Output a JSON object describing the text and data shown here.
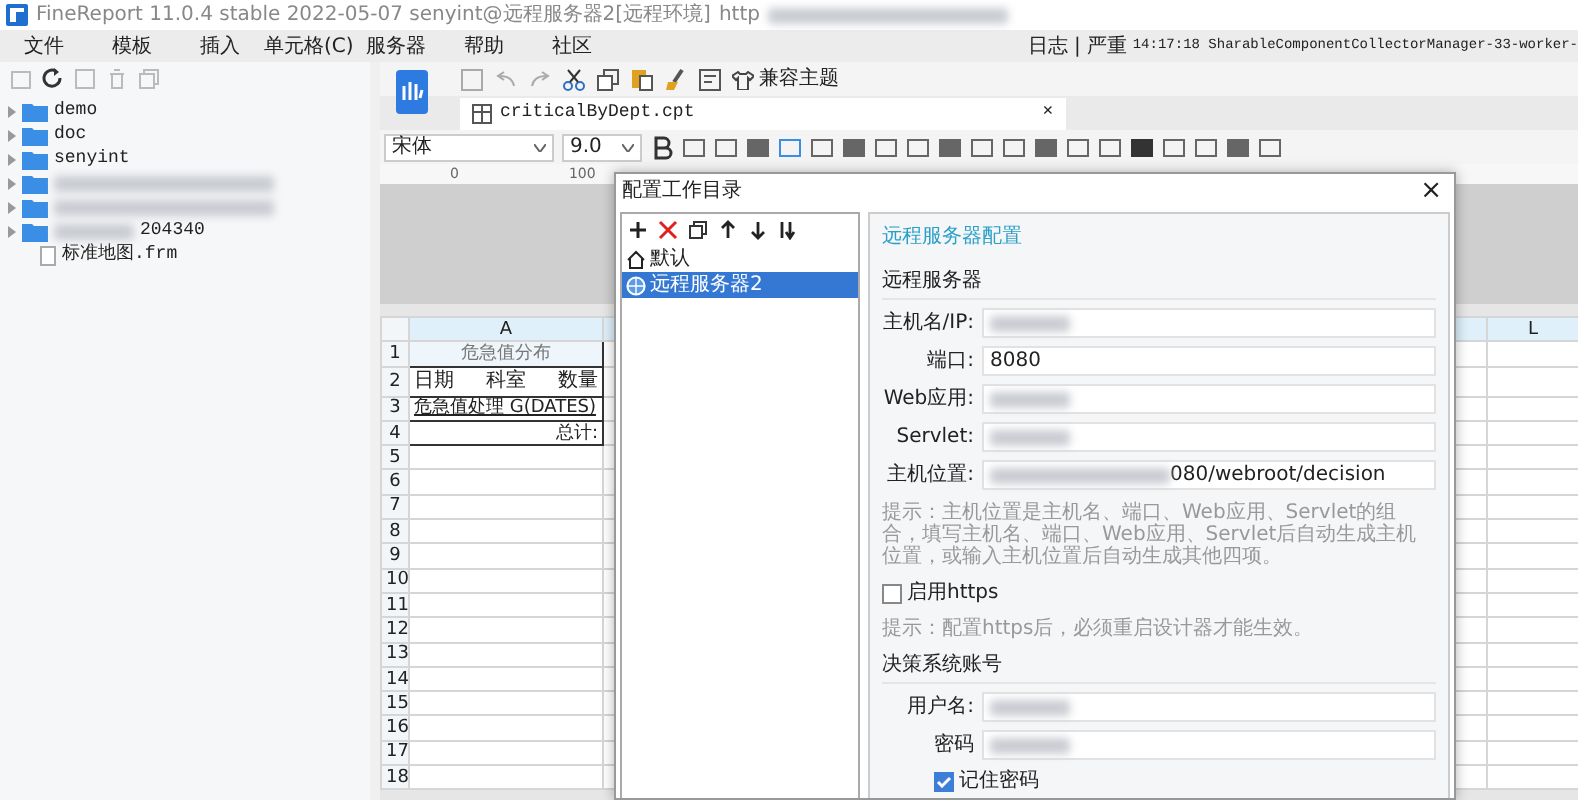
{
  "window": {
    "title": "FineReport 11.0.4 stable 2022-05-07 senyint@远程服务器2[远程环境]",
    "url_fragment": "http"
  },
  "menu": [
    "文件",
    "模板",
    "插入",
    "单元格(C)",
    "服务器",
    "帮助",
    "社区"
  ],
  "log_bar": {
    "label": "日志",
    "separator": "|",
    "level": "严重",
    "message": "14:17:18 SharableComponentCollectorManager-33-worker-"
  },
  "file_tree": [
    {
      "kind": "folder",
      "label": "demo"
    },
    {
      "kind": "folder",
      "label": "doc"
    },
    {
      "kind": "folder",
      "label": "senyint"
    },
    {
      "kind": "folder",
      "redacted": true
    },
    {
      "kind": "folder",
      "redacted": true
    },
    {
      "kind": "folder",
      "label": "204340",
      "redacted": true
    },
    {
      "kind": "file",
      "label": "标准地图.frm"
    }
  ],
  "toolbar": {
    "theme_button": "兼容主题"
  },
  "tabs": [
    {
      "label": "criticalByDept.cpt",
      "selected": true,
      "close": "×"
    }
  ],
  "format_bar": {
    "font": "宋体",
    "size": "9.0"
  },
  "ruler": [
    "0",
    "100"
  ],
  "sheet": {
    "columns": [
      "A",
      "L"
    ],
    "rows": [
      "1",
      "2",
      "3",
      "4",
      "5",
      "6",
      "7",
      "8",
      "9",
      "10",
      "11",
      "12",
      "13",
      "14",
      "15",
      "16",
      "17",
      "18"
    ],
    "title_cell": "危急值分布",
    "slash_header": [
      "日期",
      "科室",
      "数量"
    ],
    "data_cell": "危急值处理 G(DATES)",
    "total_label": "总计:"
  },
  "dialog": {
    "title": "配置工作目录",
    "close": "×",
    "tree": [
      {
        "kind": "local",
        "label": "默认",
        "selected": false
      },
      {
        "kind": "remote",
        "label": "远程服务器2",
        "selected": true
      }
    ],
    "heading": "远程服务器配置",
    "server_section": "远程服务器",
    "server_fields": [
      {
        "label": "主机名/IP:",
        "redacted": true
      },
      {
        "label": "端口:",
        "value": "8080"
      },
      {
        "label": "Web应用:",
        "redacted": true
      },
      {
        "label": "Servlet:",
        "redacted": true
      },
      {
        "label": "主机位置:",
        "value": "080/webroot/decision",
        "redacted": true
      }
    ],
    "hint": "提示：主机位置是主机名、端口、Web应用、Servlet的组合，填写主机名、端口、Web应用、Servlet后自动生成主机位置，或输入主机位置后自动生成其他四项。",
    "https": {
      "label": "启用https",
      "checked": false
    },
    "https_hint": "提示：配置https后，必须重启设计器才能生效。",
    "account_section": "决策系统账号",
    "account_fields": [
      {
        "label": "用户名:",
        "redacted": true
      },
      {
        "label": "密码",
        "redacted": true
      }
    ],
    "remember": {
      "label": "记住密码",
      "checked": true
    }
  }
}
